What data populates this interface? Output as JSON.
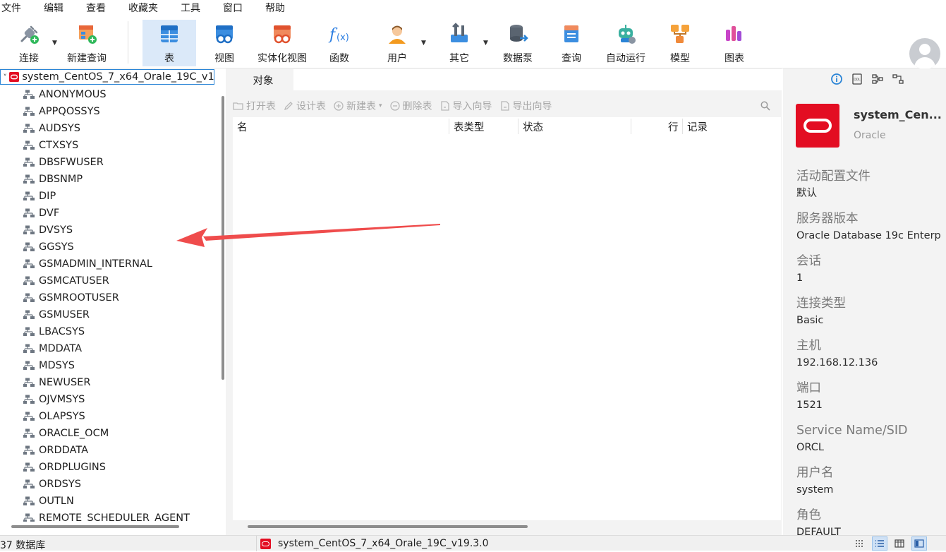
{
  "menu": [
    "文件",
    "编辑",
    "查看",
    "收藏夹",
    "工具",
    "窗口",
    "帮助"
  ],
  "toolbar": {
    "connect": "连接",
    "new_query": "新建查询",
    "table": "表",
    "view": "视图",
    "materialized_view": "实体化视图",
    "function": "函数",
    "user": "用户",
    "others": "其它",
    "data_pump": "数据泵",
    "query": "查询",
    "automation": "自动运行",
    "model": "模型",
    "chart": "图表",
    "active": "table"
  },
  "tree": {
    "root_label": "system_CentOS_7_x64_Orale_19C_v19.3.0",
    "items": [
      "ANONYMOUS",
      "APPQOSSYS",
      "AUDSYS",
      "CTXSYS",
      "DBSFWUSER",
      "DBSNMP",
      "DIP",
      "DVF",
      "DVSYS",
      "GGSYS",
      "GSMADMIN_INTERNAL",
      "GSMCATUSER",
      "GSMROOTUSER",
      "GSMUSER",
      "LBACSYS",
      "MDDATA",
      "MDSYS",
      "NEWUSER",
      "OJVMSYS",
      "OLAPSYS",
      "ORACLE_OCM",
      "ORDDATA",
      "ORDPLUGINS",
      "ORDSYS",
      "OUTLN",
      "REMOTE_SCHEDULER_AGENT"
    ]
  },
  "objects": {
    "tab_label": "对象",
    "actions": {
      "open": "打开表",
      "design": "设计表",
      "new": "新建表",
      "delete": "删除表",
      "import": "导入向导",
      "export": "导出向导"
    },
    "columns": {
      "name": "名",
      "table_type": "表类型",
      "status": "状态",
      "rows": "行",
      "records": "记录"
    }
  },
  "info": {
    "connection_name": "system_Cen...",
    "connection_type": "Oracle",
    "props": [
      {
        "label": "活动配置文件",
        "value": "默认"
      },
      {
        "label": "服务器版本",
        "value": "Oracle Database 19c Enterp"
      },
      {
        "label": "会话",
        "value": "1"
      },
      {
        "label": "连接类型",
        "value": "Basic"
      },
      {
        "label": "主机",
        "value": "192.168.12.136"
      },
      {
        "label": "端口",
        "value": "1521"
      },
      {
        "label": "Service Name/SID",
        "value": "ORCL"
      },
      {
        "label": "用户名",
        "value": "system"
      },
      {
        "label": "角色",
        "value": "DEFAULT"
      }
    ]
  },
  "status": {
    "db_count": "37 数据库",
    "connection": "system_CentOS_7_x64_Orale_19C_v19.3.0"
  },
  "colors": {
    "accent": "#2a84d6",
    "oracle_red": "#e30d22",
    "annotation_arrow": "#ef4c4c"
  }
}
